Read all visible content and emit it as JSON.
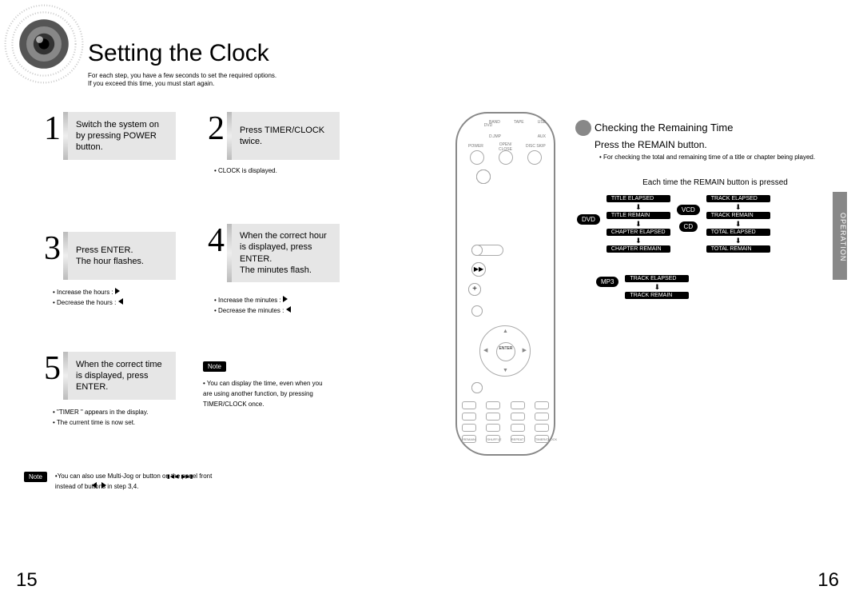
{
  "title": "Setting the Clock",
  "subtitle_line1": "For each step, you have a few seconds to set the required options.",
  "subtitle_line2": "If you exceed this time, you must start again.",
  "steps": {
    "s1": {
      "n": "1",
      "text": "Switch the system on by pressing POWER button."
    },
    "s2": {
      "n": "2",
      "text": "Press TIMER/CLOCK twice."
    },
    "s2_note": "• CLOCK  is displayed.",
    "s3": {
      "n": "3",
      "text": "Press ENTER.\nThe hour flashes."
    },
    "s3_inc": "• Increase the hours :",
    "s3_dec": "• Decrease the hours :",
    "s4": {
      "n": "4",
      "text": "When the correct hour is displayed, press ENTER.\nThe minutes flash."
    },
    "s4_inc": "• Increase the minutes :",
    "s4_dec": "• Decrease the minutes :",
    "s5": {
      "n": "5",
      "text": "When the correct time is displayed, press ENTER."
    },
    "s5_n1": "• \"TIMER \" appears in the display.",
    "s5_n2": "• The current time is now set."
  },
  "note_label": "Note",
  "note_side": "• You can display the time, even when you are using another function, by pressing TIMER/CLOCK once.",
  "note_bottom_line1": "•You can also  use Multi-Jog or               button on  the panel front",
  "note_bottom_line2": "instead of           buttons in step 3,4.",
  "page_left_num": "15",
  "page_right_num": "16",
  "side_tab": "OPERATION",
  "checking": {
    "title": "Checking the Remaining Time",
    "sub": "Press the REMAIN button.",
    "bullet": "• For checking the total and remaining time of a title or chapter being played.",
    "head": "Each time the REMAIN button is pressed",
    "badges": {
      "dvd": "DVD",
      "vcd": "VCD",
      "cd": "CD",
      "mp3": "MP3",
      "te": "TITLE ELAPSED",
      "tr": "TITLE REMAIN",
      "ce": "CHAPTER ELAPSED",
      "cr": "CHAPTER REMAIN",
      "tke": "TRACK ELAPSED",
      "tkr": "TRACK REMAIN",
      "toe": "TOTAL ELAPSED",
      "tor": "TOTAL REMAIN"
    }
  },
  "remote": {
    "power": "POWER",
    "open": "OPEN/\nCLOSE",
    "disc": "DISC SKIP",
    "enter": "ENTER",
    "row_top": [
      "DVD",
      "BAND",
      "TAPE",
      "USB"
    ],
    "row_top2": [
      "D.JMP",
      "",
      "AUX"
    ],
    "bottom": [
      "REMAIN",
      "SHUFFLE",
      "REPEAT",
      "TIMER/CLOCK"
    ]
  }
}
